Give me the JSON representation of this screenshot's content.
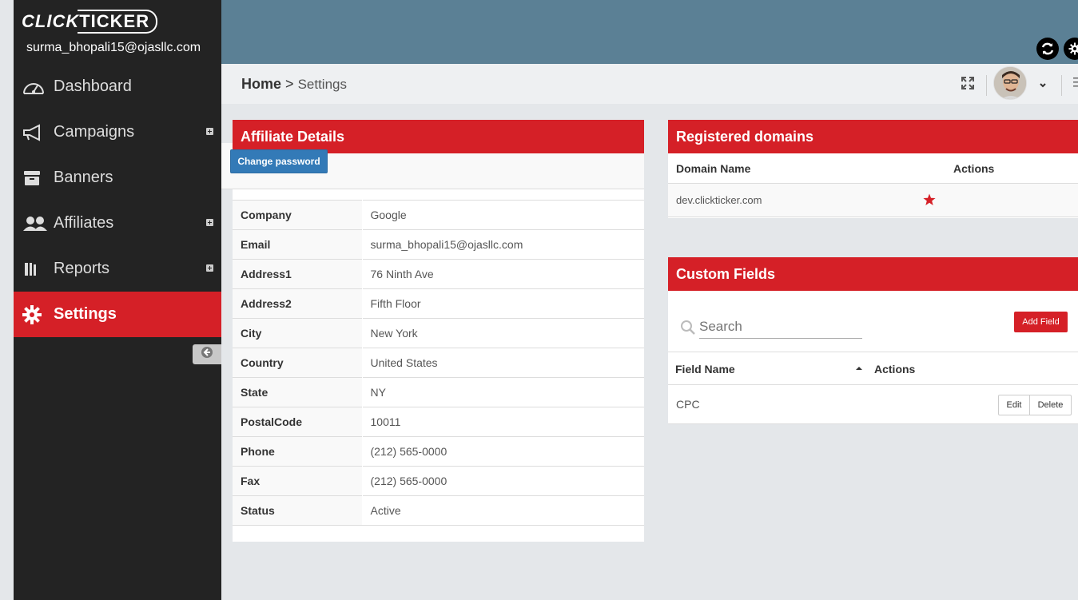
{
  "brand": {
    "logo_part1": "CLICK",
    "logo_part2": "TICKER"
  },
  "user": {
    "email": "surma_bhopali15@ojasllc.com"
  },
  "sidebar": {
    "items": [
      {
        "label": "Dashboard",
        "icon": "dashboard-gauge-icon",
        "expandable": false
      },
      {
        "label": "Campaigns",
        "icon": "megaphone-icon",
        "expandable": true
      },
      {
        "label": "Banners",
        "icon": "archive-box-icon",
        "expandable": false
      },
      {
        "label": "Affiliates",
        "icon": "users-icon",
        "expandable": true
      },
      {
        "label": "Reports",
        "icon": "bar-chart-icon",
        "expandable": true
      },
      {
        "label": "Settings",
        "icon": "gear-icon",
        "expandable": false,
        "active": true
      }
    ]
  },
  "header": {
    "icons": [
      "refresh-icon",
      "settings-gear-icon"
    ]
  },
  "breadcrumb": {
    "home": "Home",
    "separator": ">",
    "current": "Settings"
  },
  "affiliate": {
    "title": "Affiliate Details",
    "change_password_label": "Change password",
    "fields": [
      {
        "key": "Company",
        "value": "Google"
      },
      {
        "key": "Email",
        "value": "surma_bhopali15@ojasllc.com"
      },
      {
        "key": "Address1",
        "value": "76 Ninth Ave"
      },
      {
        "key": "Address2",
        "value": "Fifth Floor"
      },
      {
        "key": "City",
        "value": "New York"
      },
      {
        "key": "Country",
        "value": "United States"
      },
      {
        "key": "State",
        "value": "NY"
      },
      {
        "key": "PostalCode",
        "value": "10011"
      },
      {
        "key": "Phone",
        "value": "(212) 565-0000"
      },
      {
        "key": "Fax",
        "value": "(212) 565-0000"
      },
      {
        "key": "Status",
        "value": "Active"
      }
    ]
  },
  "domains": {
    "title": "Registered domains",
    "col_name": "Domain Name",
    "col_actions": "Actions",
    "rows": [
      {
        "name": "dev.clickticker.com",
        "starred": true
      }
    ]
  },
  "custom_fields": {
    "title": "Custom Fields",
    "search_placeholder": "Search",
    "add_label": "Add Field",
    "col_name": "Field Name",
    "col_actions": "Actions",
    "rows": [
      {
        "name": "CPC",
        "edit_label": "Edit",
        "delete_label": "Delete"
      }
    ]
  },
  "colors": {
    "accent": "#d52027",
    "sidebar": "#232323",
    "topbar": "#5b8095",
    "primary_button": "#337ab7"
  }
}
